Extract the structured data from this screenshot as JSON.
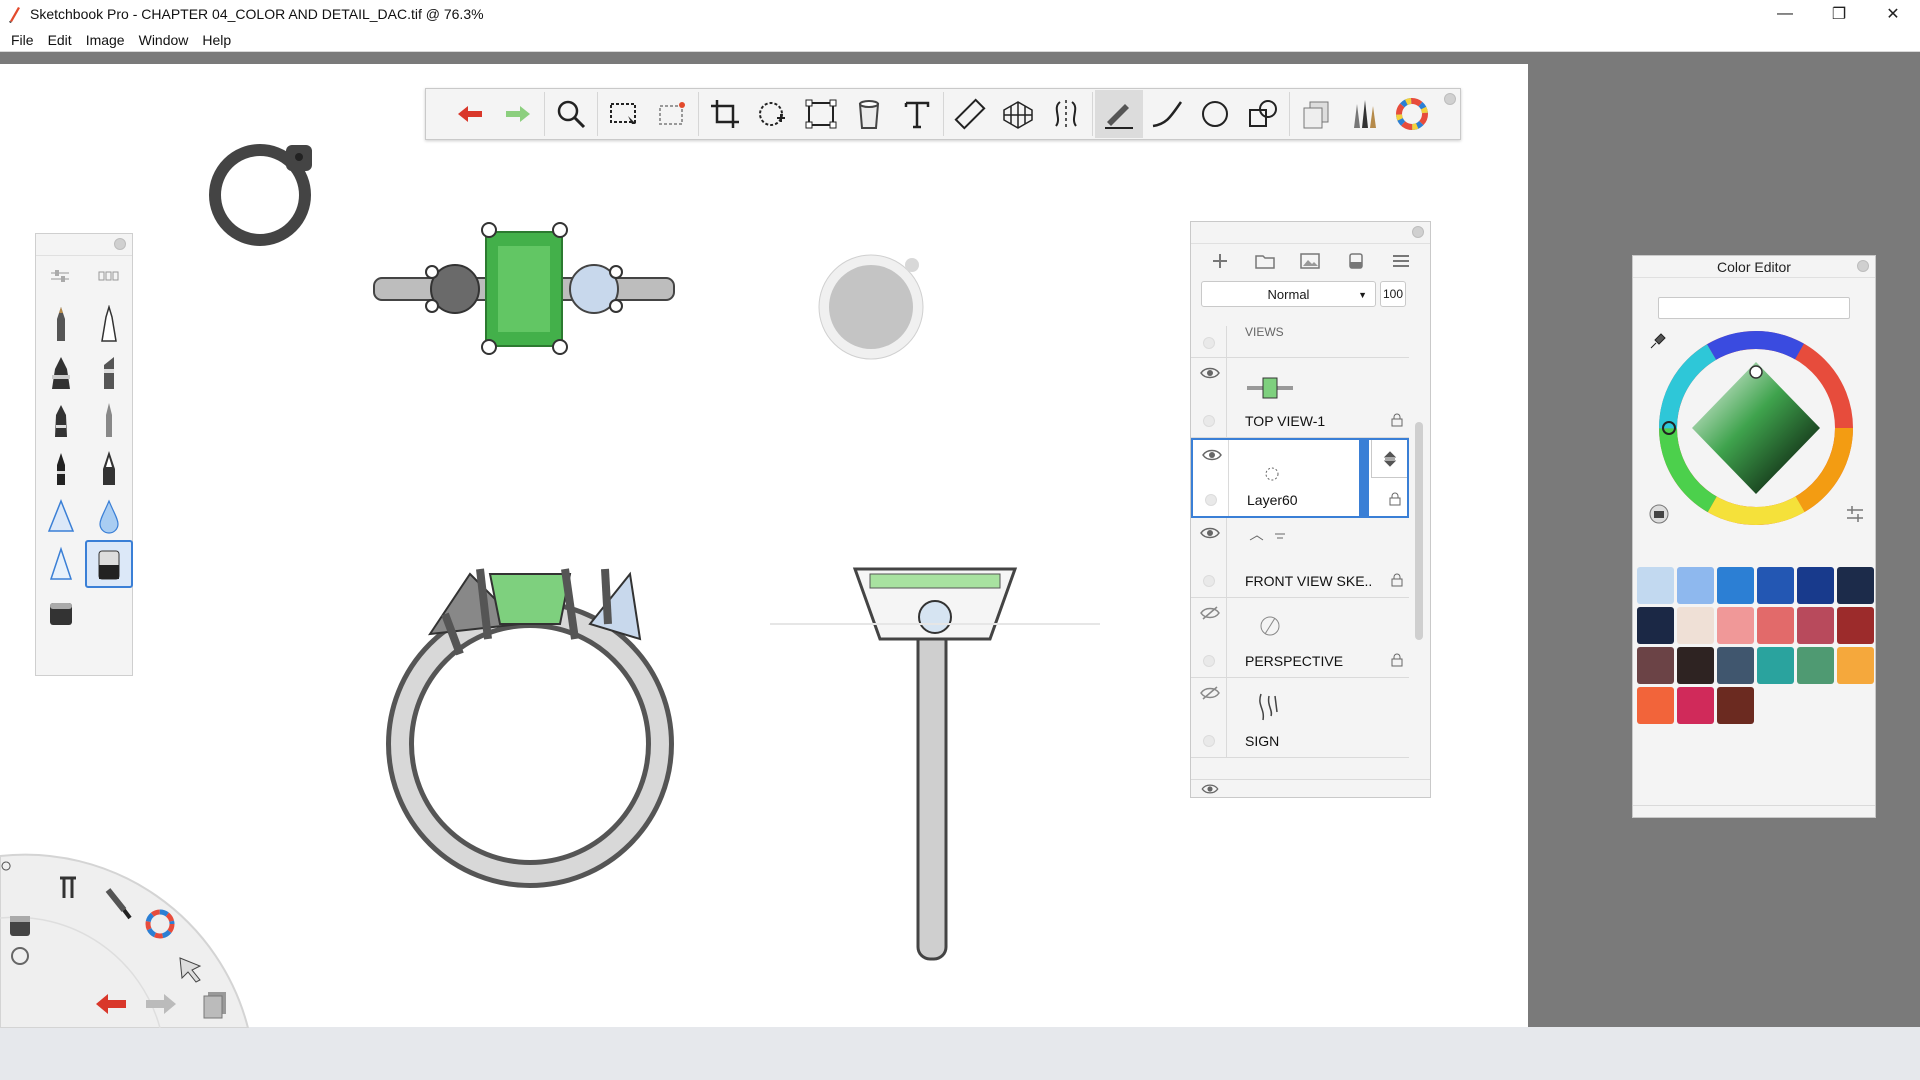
{
  "window": {
    "title": "Sketchbook Pro - CHAPTER 04_COLOR AND DETAIL_DAC.tif @ 76.3%",
    "minimize_icon": "minimize-icon",
    "maximize_icon": "restore-icon",
    "close_icon": "close-icon"
  },
  "menu": {
    "items": [
      "File",
      "Edit",
      "Image",
      "Window",
      "Help"
    ]
  },
  "toolbar": {
    "tools": [
      "undo-icon",
      "redo-icon",
      "zoom-icon",
      "select-icon",
      "select-paste-icon",
      "crop-icon",
      "transform-icon",
      "distort-icon",
      "fill-icon",
      "text-icon",
      "ruler-icon",
      "perspective-icon",
      "symmetry-icon",
      "brush-stroke-icon",
      "curve-icon",
      "ellipse-icon",
      "shapes-icon",
      "layer-copy-icon",
      "brush-library-icon",
      "color-wheel-icon"
    ]
  },
  "brush_palette": {
    "header_icons": [
      "brush-settings-icon",
      "brush-library-icon"
    ],
    "brushes": [
      "pencil",
      "technical-pen",
      "marker",
      "chisel-marker",
      "felt-pen",
      "fine-pencil",
      "ink-pen",
      "fountain-pen",
      "airbrush",
      "water-drop",
      "hard-airbrush",
      "eraser",
      "smudge-eraser"
    ],
    "selected_brush": "eraser"
  },
  "layers": {
    "blend_mode": "Normal",
    "opacity": "100",
    "partial_label": "VIEWS",
    "items": [
      {
        "name": "TOP VIEW-1",
        "visible": true,
        "locked": true
      },
      {
        "name": "Layer60",
        "visible": true,
        "locked": true,
        "selected": true
      },
      {
        "name": "FRONT VIEW SKE..",
        "visible": true,
        "locked": true
      },
      {
        "name": "PERSPECTIVE",
        "visible": false,
        "locked": true
      },
      {
        "name": "SIGN",
        "visible": false,
        "locked": false
      }
    ]
  },
  "color_editor": {
    "title": "Color Editor",
    "hex_value": "",
    "current_color": "#3fa34d",
    "swatches": [
      "#c2d9f0",
      "#8eb8ee",
      "#2c7fd4",
      "#2357b3",
      "#183a8c",
      "#1c2b4a",
      "#1b2845",
      "#efe0d6",
      "#f09898",
      "#e26a6a",
      "#b84a5c",
      "#9c2b2b",
      "#6b4346",
      "#2e2322",
      "#40566e",
      "#2aa39e",
      "#4f9a72",
      "#f5a83c",
      "#f2643a",
      "#d02a5a",
      "#6b2a20"
    ]
  },
  "colors": {
    "accent": "#3a7fd6",
    "gem_green": "#43b04a",
    "canvas": "#ffffff",
    "workspace": "#7a7a7a"
  }
}
